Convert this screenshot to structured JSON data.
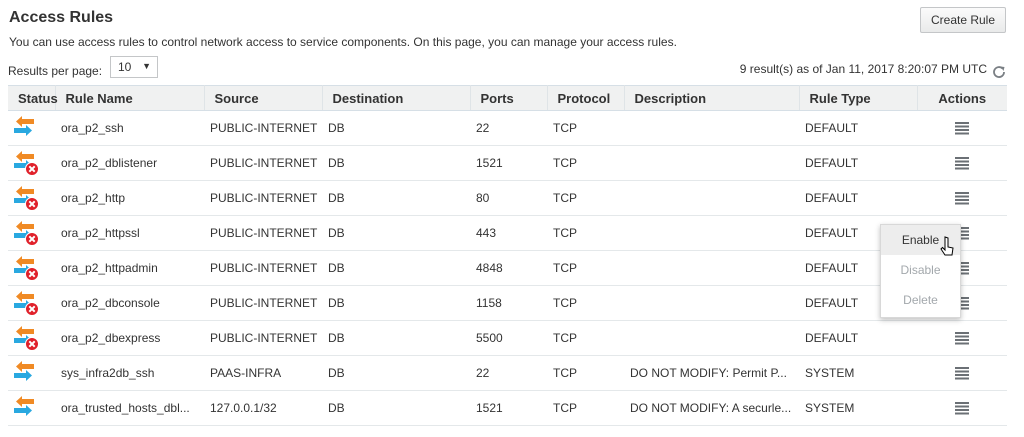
{
  "page": {
    "title": "Access Rules",
    "description": "You can use access rules to control network access to service components. On this page, you can manage your access rules.",
    "create_button": "Create Rule"
  },
  "pagination": {
    "results_per_page_label": "Results per page:",
    "results_per_page_value": "10",
    "results_summary": "9 result(s) as of Jan 11, 2017 8:20:07 PM UTC"
  },
  "table": {
    "headers": [
      "Status",
      "Rule Name",
      "Source",
      "Destination",
      "Ports",
      "Protocol",
      "Description",
      "Rule Type",
      "Actions"
    ],
    "rows": [
      {
        "status": "enabled",
        "name": "ora_p2_ssh",
        "source": "PUBLIC-INTERNET",
        "destination": "DB",
        "ports": "22",
        "protocol": "TCP",
        "description": "",
        "type": "DEFAULT"
      },
      {
        "status": "disabled",
        "name": "ora_p2_dblistener",
        "source": "PUBLIC-INTERNET",
        "destination": "DB",
        "ports": "1521",
        "protocol": "TCP",
        "description": "",
        "type": "DEFAULT"
      },
      {
        "status": "disabled",
        "name": "ora_p2_http",
        "source": "PUBLIC-INTERNET",
        "destination": "DB",
        "ports": "80",
        "protocol": "TCP",
        "description": "",
        "type": "DEFAULT"
      },
      {
        "status": "disabled",
        "name": "ora_p2_httpssl",
        "source": "PUBLIC-INTERNET",
        "destination": "DB",
        "ports": "443",
        "protocol": "TCP",
        "description": "",
        "type": "DEFAULT"
      },
      {
        "status": "disabled",
        "name": "ora_p2_httpadmin",
        "source": "PUBLIC-INTERNET",
        "destination": "DB",
        "ports": "4848",
        "protocol": "TCP",
        "description": "",
        "type": "DEFAULT"
      },
      {
        "status": "disabled",
        "name": "ora_p2_dbconsole",
        "source": "PUBLIC-INTERNET",
        "destination": "DB",
        "ports": "1158",
        "protocol": "TCP",
        "description": "",
        "type": "DEFAULT"
      },
      {
        "status": "disabled",
        "name": "ora_p2_dbexpress",
        "source": "PUBLIC-INTERNET",
        "destination": "DB",
        "ports": "5500",
        "protocol": "TCP",
        "description": "",
        "type": "DEFAULT"
      },
      {
        "status": "enabled",
        "name": "sys_infra2db_ssh",
        "source": "PAAS-INFRA",
        "destination": "DB",
        "ports": "22",
        "protocol": "TCP",
        "description": "DO NOT MODIFY: Permit P...",
        "type": "SYSTEM"
      },
      {
        "status": "enabled",
        "name": "ora_trusted_hosts_dbl...",
        "source": "127.0.0.1/32",
        "destination": "DB",
        "ports": "1521",
        "protocol": "TCP",
        "description": "DO NOT MODIFY: A securle...",
        "type": "SYSTEM"
      }
    ]
  },
  "context_menu": {
    "items": [
      {
        "label": "Enable",
        "state": "hover"
      },
      {
        "label": "Disable",
        "state": "disabled"
      },
      {
        "label": "Delete",
        "state": "disabled"
      }
    ]
  },
  "icons": {
    "status_enabled": "rule-enabled-icon",
    "status_disabled": "rule-disabled-icon",
    "actions": "hamburger-menu-icon",
    "refresh": "refresh-icon"
  },
  "colors": {
    "arrow_blue": "#29a8e0",
    "arrow_orange": "#f08a24",
    "error_red": "#e0202a",
    "header_bg": "#f0f1f1"
  }
}
